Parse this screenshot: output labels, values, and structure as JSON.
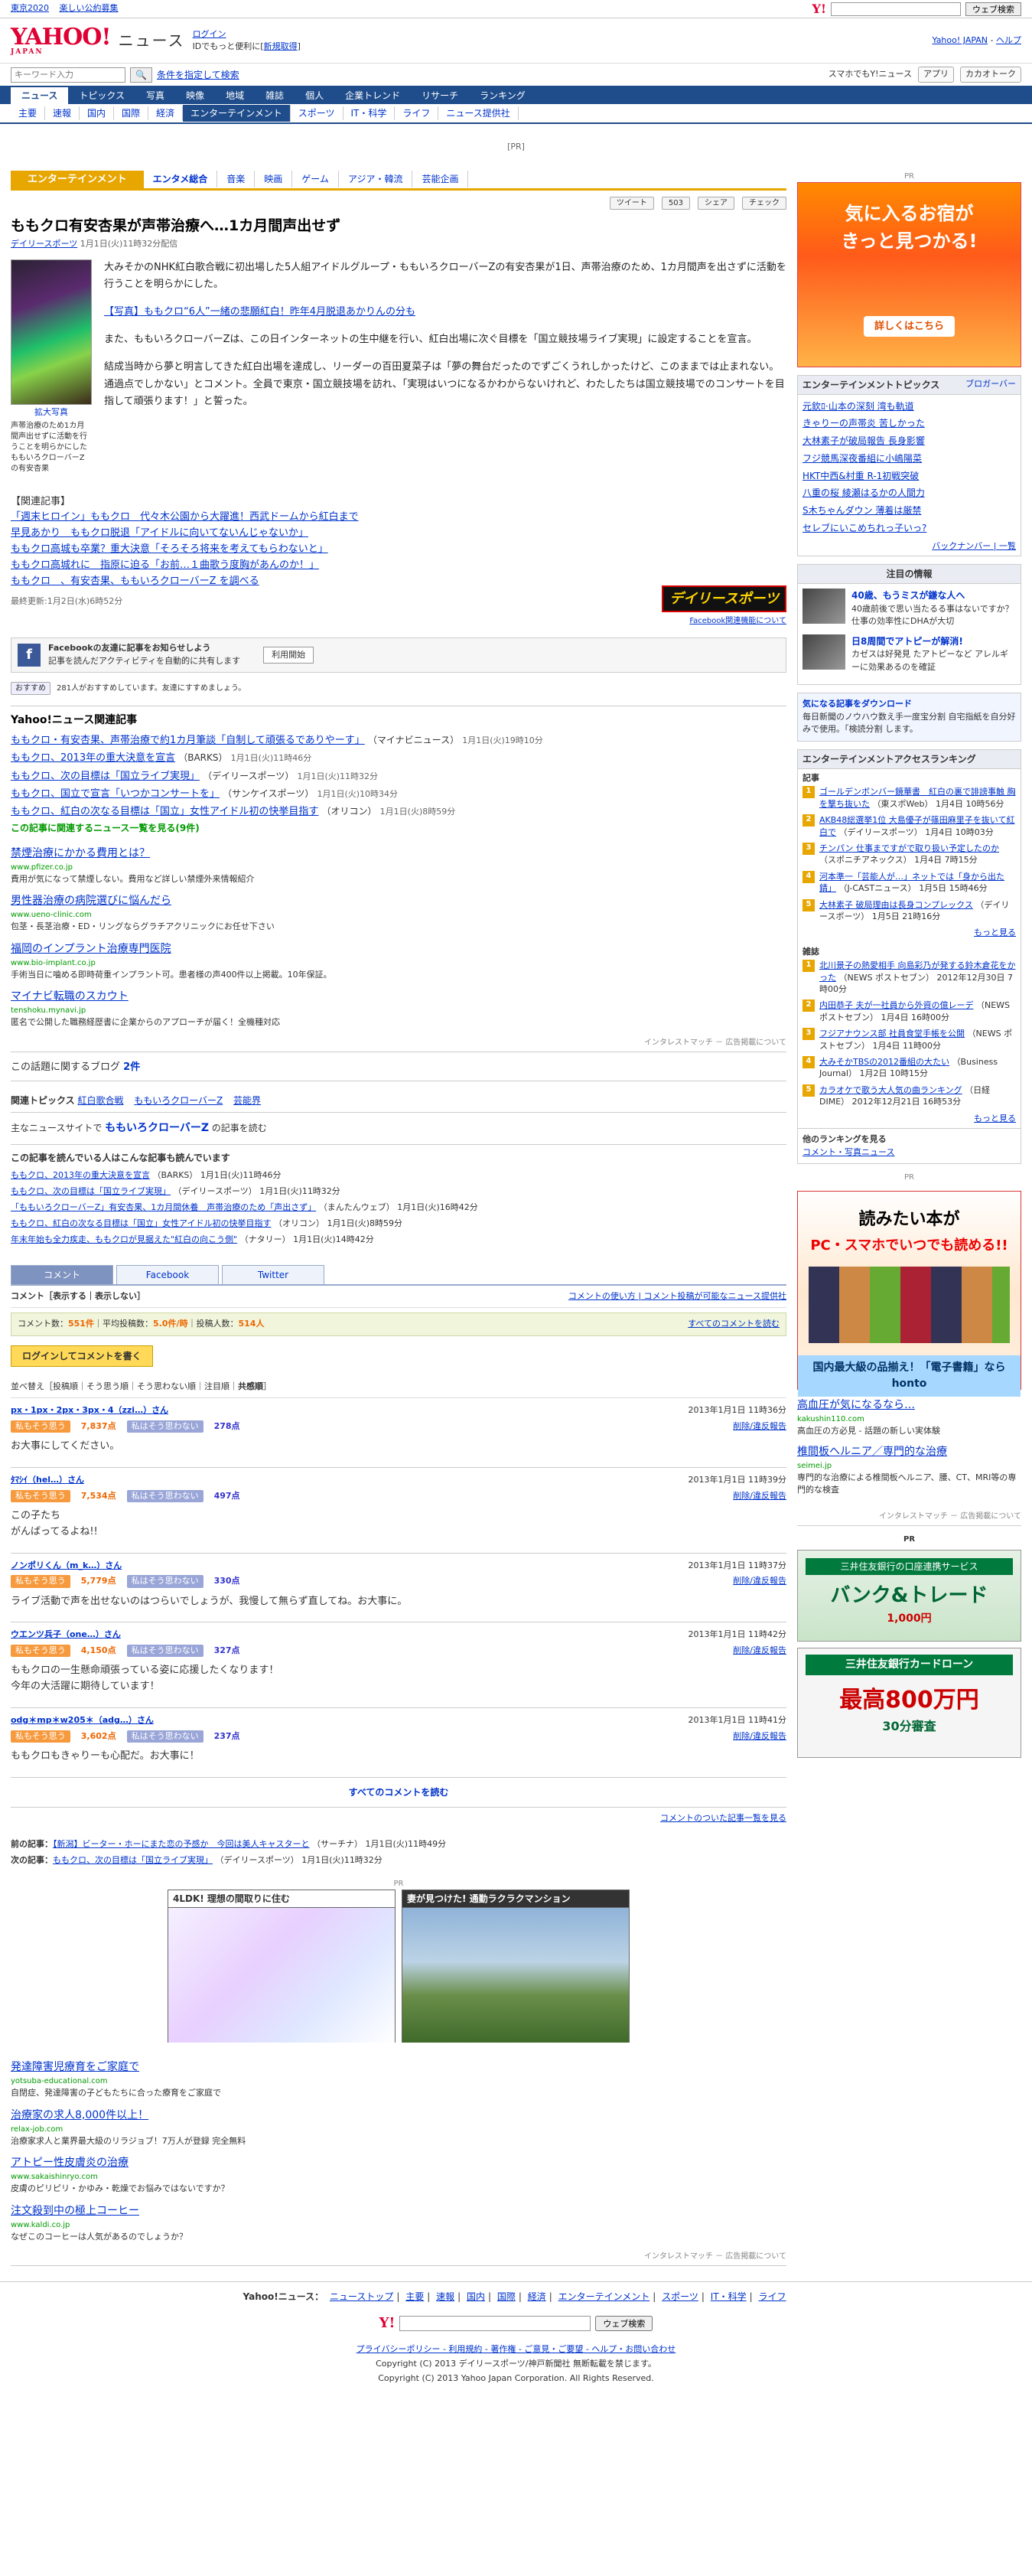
{
  "topbar": {
    "left": [
      "東京2020",
      "楽しい公約募集"
    ],
    "search_placeholder": "",
    "search_btn": "ウェブ検索"
  },
  "header": {
    "logo": "YAHOO!",
    "logo_sub": "JAPAN",
    "site": "ニュース",
    "login": "ログイン",
    "login_sub": "IDでもっと便利に[",
    "signup": "新規取得",
    "login_end": "]",
    "right": [
      "Yahoo! JAPAN",
      "ヘルプ"
    ]
  },
  "searchbar": {
    "placeholder": "キーワード入力",
    "btn": "条件を指定して検索",
    "right": [
      "スマホでもY!ニュース",
      "アプリ",
      "カカオトーク"
    ]
  },
  "nav1": [
    "ニュース",
    "トピックス",
    "写真",
    "映像",
    "地域",
    "雑誌",
    "個人",
    "企業トレンド",
    "リサーチ",
    "ランキング"
  ],
  "nav2": [
    "主要",
    "速報",
    "国内",
    "国際",
    "経済",
    "エンターテインメント",
    "スポーツ",
    "IT・科学",
    "ライフ",
    "ニュース提供社"
  ],
  "pr": "[PR]",
  "cattabs": {
    "current": "エンターテインメント",
    "items": [
      "エンタメ総合",
      "音楽",
      "映画",
      "ゲーム",
      "アジア・韓流",
      "芸能企画"
    ]
  },
  "share": {
    "tweet": "ツイート",
    "tweet_count": "503",
    "fb": "シェア",
    "check": "チェック"
  },
  "article": {
    "title": "ももクロ有安杏果が声帯治療へ…1カ月間声出せず",
    "source": "デイリースポーツ",
    "date": "1月1日(火)11時32分配信",
    "photo_label": "拡大写真",
    "photo_caption": "声帯治療のため1カ月間声出せずに活動を行うことを明らかにしたももいろクローバーZの有安杏果",
    "p1": "大みそかのNHK紅白歌合戦に初出場した5人組アイドルグループ・ももいろクローバーZの有安杏果が1日、声帯治療のため、1カ月間声を出さずに活動を行うことを明らかにした。",
    "p2": "【写真】ももクロ“6人”一緒の悲願紅白！昨年4月脱退あかりんの分も",
    "p3": "また、ももいろクローバーZは、この日インターネットの生中継を行い、紅白出場に次ぐ目標を「国立競技場ライブ実現」に設定することを宣言。",
    "p4": "結成当時から夢と明言してきた紅白出場を達成し、リーダーの百田夏菜子は「夢の舞台だったのでずごくうれしかったけど、このままでは止まれない。通過点でしかない」とコメント。全員で東京・国立競技場を訪れ、「実現はいつになるかわからないけれど、わたしたちは国立競技場でのコンサートを目指して頑張ります！」と誓った。",
    "related_h": "【関連記事】",
    "related": [
      "「週末ヒロイン」ももクロ　代々木公園から大躍進！西武ドームから紅白まで",
      "早見あかり　ももクロ脱退「アイドルに向いてないんじゃないか」",
      "ももクロ高城も卒業？重大決意「そろそろ将来を考えてもらわないと」",
      "ももクロ高城れに　指原に迫る「お前…１曲歌う度胸があんのか！」",
      "ももクロ　、有安杏果、ももいろクローバーZ を調べる"
    ],
    "updated": "最終更新:1月2日(水)6時52分",
    "logo_d": "デイリースポーツ",
    "fb_note": "Facebook関連機能について"
  },
  "fbbox": {
    "title": "Facebookの友達に記事をお知らせしよう",
    "sub": "記事を読んだアクティビティを自動的に共有します",
    "btn": "利用開始"
  },
  "like": {
    "btn": "おすすめ",
    "count": "281人がおすすめしています。友達にすすめましょう。"
  },
  "related_news": {
    "head": "Yahoo!ニュース関連記事",
    "items": [
      {
        "t": "ももクロ・有安杏果、声帯治療で約1カ月筆談「自制して頑張るでありやーす」",
        "s": "（マイナビニュース）",
        "d": "1月1日(火)19時10分"
      },
      {
        "t": "ももクロ、2013年の重大決意を宣言",
        "s": "（BARKS）",
        "d": "1月1日(火)11時46分"
      },
      {
        "t": "ももクロ、次の目標は「国立ライブ実現」",
        "s": "（デイリースポーツ）",
        "d": "1月1日(火)11時32分"
      },
      {
        "t": "ももクロ、国立で宣言「いつかコンサートを」",
        "s": "（サンケイスポーツ）",
        "d": "1月1日(火)10時34分"
      },
      {
        "t": "ももクロ、紅白の次なる目標は「国立」女性アイドル初の快挙目指す",
        "s": "（オリコン）",
        "d": "1月1日(火)8時59分"
      }
    ],
    "more": "この記事に関連するニュース一覧を見る(9件)"
  },
  "ads1": [
    {
      "t": "禁煙治療にかかる費用とは？",
      "u": "www.pfizer.co.jp",
      "d": "費用が気になって禁煙しない。費用など詳しい禁煙外来情報紹介"
    },
    {
      "t": "男性器治療の病院選びに悩んだら",
      "u": "www.ueno-clinic.com",
      "d": "包茎・長茎治療・ED・リングならグラチアクリニックにお任せ下さい"
    },
    {
      "t": "福岡のインプラント治療専門医院",
      "u": "www.bio-implant.co.jp",
      "d": "手術当日に噛める即時荷重インプラント可。患者様の声400件以上掲載。10年保証。"
    },
    {
      "t": "マイナビ転職のスカウト",
      "u": "tenshoku.mynavi.jp",
      "d": "匿名で公開した職務経歴書に企業からのアプローチが届く！全機種対応"
    }
  ],
  "adfoot": "インタレストマッチ － 広告掲載について",
  "blog": {
    "pre": "この話題に関するブログ",
    "count": "2件"
  },
  "topics": {
    "pre": "関連トピックス",
    "items": [
      "紅白歌合戦",
      "ももいろクローバーZ",
      "芸能界"
    ]
  },
  "mainsite": {
    "pre": "主なニュースサイトで",
    "kw": "ももいろクローバーZ",
    "post": "の記事を読む"
  },
  "readers": {
    "head": "この記事を読んでいる人はこんな記事も読んでいます",
    "items": [
      {
        "t": "ももクロ、2013年の重大決意を宣言",
        "s": "（BARKS）",
        "d": "1月1日(火)11時46分"
      },
      {
        "t": "ももクロ、次の目標は「国立ライブ実現」",
        "s": "（デイリースポーツ）",
        "d": "1月1日(火)11時32分"
      },
      {
        "t": "「ももいろクローバーZ」有安杏果、1カ月間休養　声帯治療のため「声出さず」",
        "s": "（まんたんウェブ）",
        "d": "1月1日(火)16時42分"
      },
      {
        "t": "ももクロ、紅白の次なる目標は「国立」女性アイドル初の快挙目指す",
        "s": "（オリコン）",
        "d": "1月1日(火)8時59分"
      },
      {
        "t": "年末年始も全力疾走、ももクロが見据えた\"紅白の向こう側\"",
        "s": "（ナタリー）",
        "d": "1月1日(火)14時42分"
      }
    ]
  },
  "ctabs": [
    "コメント",
    "Facebook",
    "Twitter"
  ],
  "cbar": {
    "head": "コメント［表示する｜表示しない］",
    "right": "コメントの使い方 | コメント投稿が可能なニュース提供社"
  },
  "cstats": {
    "l1": "コメント数：",
    "v1": "551件",
    "l2": "平均投稿数：",
    "v2": "5.0件/時",
    "l3": "投稿人数：",
    "v3": "514人",
    "all": "すべてのコメントを読む"
  },
  "loginbtn": "ログインしてコメントを書く",
  "sort": "並べ替え［投稿順｜そう思う順｜そう思わない順｜注目順｜",
  "sort_on": "共感順",
  "comments": [
    {
      "n": "px・1px・2px・3px・4（zzi…）さん",
      "d": "2013年1月1日 11時36分",
      "a": "7,837点",
      "b": "278点",
      "t": "お大事にしてください。"
    },
    {
      "n": "ﾀﾏｼｲ（hel…）さん",
      "d": "2013年1月1日 11時39分",
      "a": "7,534点",
      "b": "497点",
      "t": "この子たち\nがんばってるよね!!"
    },
    {
      "n": "ノンポリくん（m_k…）さん",
      "d": "2013年1月1日 11時37分",
      "a": "5,779点",
      "b": "330点",
      "t": "ライブ活動で声を出せないのはつらいでしょうが、我慢して無らず直してね。お大事に。"
    },
    {
      "n": "ウエンツ兵子（one…）さん",
      "d": "2013年1月1日 11時42分",
      "a": "4,150点",
      "b": "327点",
      "t": "ももクロの一生懸命頑張っている姿に応援したくなります！\n今年の大活躍に期待しています！"
    },
    {
      "n": "odg＊mp＊w205＊（adg…）さん",
      "d": "2013年1月1日 11時41分",
      "a": "3,602点",
      "b": "237点",
      "t": "ももクロもきゃりーも心配だ。お大事に！"
    }
  ],
  "agree": "私もそう思う",
  "disagree": "私はそう思わない",
  "delete": "削除/違反報告",
  "allcomments": "すべてのコメントを読む",
  "commentlist": "コメントのついた記事一覧を見る",
  "prevnext": {
    "prev_l": "前の記事：",
    "prev": "【新潟】ビーター・ホーにまた恋の予感か　今回は美人キャスターと",
    "prev_s": "（サーチナ）",
    "prev_d": "1月1日(火)11時49分",
    "next_l": "次の記事：",
    "next": "ももクロ、次の目標は「国立ライブ実現」",
    "next_s": "（デイリースポーツ）",
    "next_d": "1月1日(火)11時32分"
  },
  "bigpr": {
    "label": "PR",
    "a": "4LDK! 理想の間取りに住む",
    "b": "妻が見つけた! 通勤ラクラクマンション"
  },
  "ads2": [
    {
      "t": "発達障害児療育をご家庭で",
      "u": "yotsuba-educational.com",
      "d": "自閉症、発達障害の子どもたちに合った療育をご家庭で"
    },
    {
      "t": "治療家の求人8,000件以上！",
      "u": "relax-job.com",
      "d": "治療家求人と業界最大級のリラジョブ！7万人が登録 完全無料"
    },
    {
      "t": "アトピー性皮膚炎の治療",
      "u": "www.sakaishinryo.com",
      "d": "皮膚のピリピリ・かゆみ・乾燥でお悩みではないですか？"
    },
    {
      "t": "注文殺到中の極上コーヒー",
      "u": "www.kaldi.co.jp",
      "d": "なぜこのコーヒーは人気があるのでしょうか？"
    }
  ],
  "adfoot2": "インタレストマッチ － 広告掲載について",
  "footnav": {
    "head": "Yahoo!ニュース：",
    "items": [
      "ニューストップ",
      "主要",
      "速報",
      "国内",
      "国際",
      "経済",
      "エンターテインメント",
      "スポーツ",
      "IT・科学",
      "ライフ"
    ]
  },
  "fsearch": {
    "btn": "ウェブ検索"
  },
  "flinks": {
    "l1": "プライバシーポリシー - 利用規約 - 著作権 - ご意見・ご要望 - ヘルプ・お問い合わせ",
    "l2": "Copyright (C) 2013 デイリースポーツ/神戸新聞社 無断転載を禁じます。",
    "l3": "Copyright (C) 2013 Yahoo Japan Corporation. All Rights Reserved."
  },
  "side": {
    "pr": "PR",
    "ad1": {
      "t1": "気に入るお宿が",
      "t2": "きっと見つかる!",
      "btn": "詳しくはこちら"
    },
    "topics": {
      "head": "エンターテインメントトピックス",
      "link": "ブロガーバー",
      "items": [
        "元欽ﾛ·山本の深刻 湾も軌道",
        "きゃりーの声帯炎 苦しかった",
        "大林素子が破局報告 長身影響",
        "フジ競馬深夜番組に小嶋陽菜",
        "HKT中西&村重 R-1初戦突破",
        "八重の桜 綾瀬はるかの人間力",
        "S木ちゃんダウン 薄着は厳禁",
        "セレブにいこめちれっ子いっ?"
      ],
      "more": "バックナンバー | 一覧"
    },
    "attn": {
      "head": "注目の情報",
      "a1": "40歳、もうミスが鎌な人へ",
      "a1s": "40歳前後で思い当たるる事はないですか？仕事の効率性にDHAが大切",
      "a2": "日8周間でアトピーが解消!",
      "a2s": "カゼスは好発見 たアトピーなど アレルギーに効果あるのを確証"
    },
    "smallpr": {
      "t": "気になる記事をダウンロード",
      "s": "毎日新聞のノウハウ数え手一度宝分割 自宅指紙を自分好みで使用。「検読分割 します。"
    },
    "rank": {
      "head": "エンターテインメントアクセスランキング",
      "h1": "記事",
      "r1": [
        {
          "t": "ゴールデンボンバー鏡華書　紅白の裏で誹謗事触 胸を撃ち抜いた",
          "s": "（東スポWeb）",
          "d": "1月4日 10時56分"
        },
        {
          "t": "AKB48総選挙1位 大島優子が篠田麻里子を抜いて紅白で",
          "s": "（デイリースポーツ）",
          "d": "1月4日 10時03分"
        },
        {
          "t": "チンパン 仕事まですがで取り扱い予定したのか",
          "s": "（スポニチアネックス）",
          "d": "1月4日 7時15分"
        },
        {
          "t": "河本準一「芸能人が…」ネットでは「身から出た錆」",
          "s": "（J-CASTニュース）",
          "d": "1月5日 15時46分"
        },
        {
          "t": "大林素子 破局理由は長身コンプレックス",
          "s": "（デイリースポーツ）",
          "d": "1月5日 21時16分"
        }
      ],
      "h2": "雑誌",
      "r2": [
        {
          "t": "北川景子の熱愛相手 向島彩乃が発する鈴木倉花をかった",
          "s": "（NEWS ポストセブン）",
          "d": "2012年12月30日 7時00分"
        },
        {
          "t": "内田恭子 夫が一社員から外資の億レーデ",
          "s": "（NEWS ポストセブン）",
          "d": "1月4日 16時00分"
        },
        {
          "t": "フジアナウンス部 社員食堂手帳を公開",
          "s": "（NEWS ポストセブン）",
          "d": "1月4日 11時00分"
        },
        {
          "t": "大みそかTBSの2012番組の大たい",
          "s": "（Business Journal）",
          "d": "1月2日 10時15分"
        },
        {
          "t": "カラオケで歌う大人気の曲ランキング",
          "s": "（日経DIME）",
          "d": "2012年12月21日 16時53分"
        }
      ],
      "more": "もっと見る",
      "other": "他のランキングを見る",
      "other_links": "コメント・写真ニュース"
    },
    "ad2": {
      "t1": "読みたい本が",
      "t2": "PC・スマホでいつでも読める!!",
      "bot": "国内最大級の品揃え！「電子書籍」ならhonto"
    },
    "sads": [
      {
        "t": "高血圧が気になるなら…",
        "u": "kakushin110.com",
        "d": "高血圧の方必見 - 話題の新しい実体験"
      },
      {
        "t": "椎間板ヘルニア／専門的な治療",
        "u": "seimei.jp",
        "d": "専門的な治療による椎間板ヘルニア、腰、CT、MRI等の専門的な検査"
      }
    ],
    "sadfoot": "インタレストマッチ － 広告掲載について",
    "bank1": {
      "h": "三井住友銀行の口座連携サービス",
      "b": "バンク&トレード",
      "r": "1,000円"
    },
    "bank2": {
      "h": "三井住友銀行カードローン",
      "b": "最高800万円",
      "r": "30分審査"
    }
  }
}
